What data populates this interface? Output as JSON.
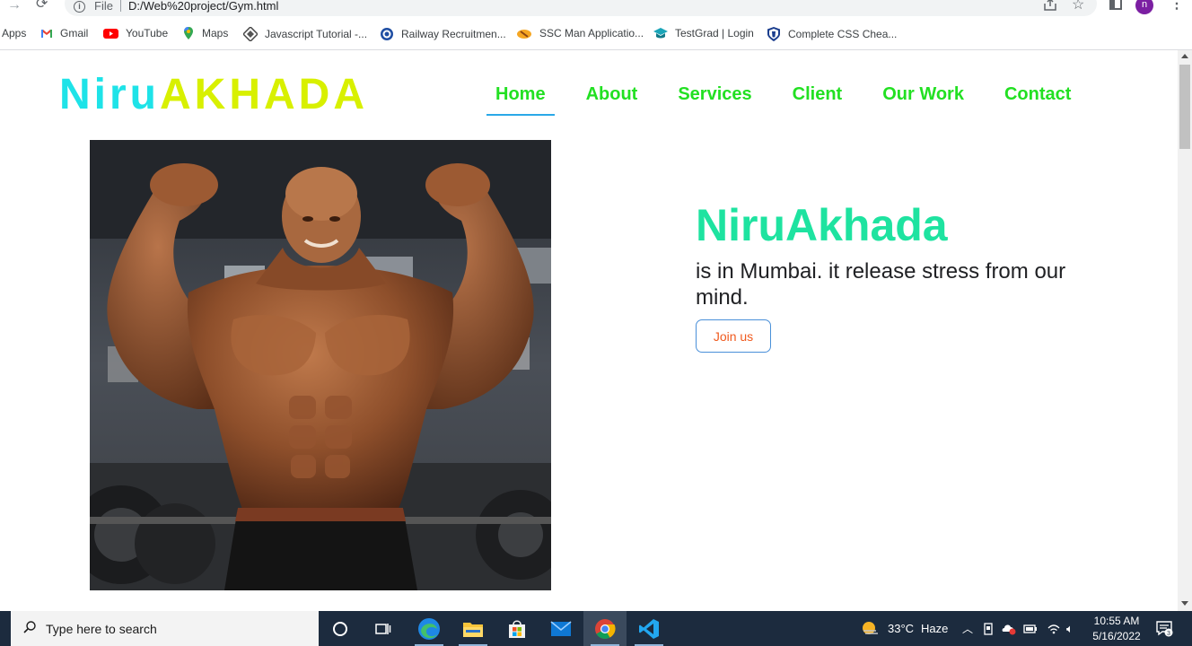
{
  "browser": {
    "url_scheme": "File",
    "url": "D:/Web%20project/Gym.html",
    "avatar_letter": "n",
    "bookmarks": [
      {
        "label": "Apps"
      },
      {
        "label": "Gmail"
      },
      {
        "label": "YouTube"
      },
      {
        "label": "Maps"
      },
      {
        "label": "Javascript Tutorial -..."
      },
      {
        "label": "Railway Recruitmen..."
      },
      {
        "label": "SSC Man Applicatio..."
      },
      {
        "label": "TestGrad | Login"
      },
      {
        "label": "Complete CSS Chea..."
      }
    ]
  },
  "site": {
    "logo_part1": "Niru",
    "logo_part2": "AKHADA",
    "nav": [
      {
        "label": "Home",
        "active": true
      },
      {
        "label": "About"
      },
      {
        "label": "Services"
      },
      {
        "label": "Client"
      },
      {
        "label": "Our Work"
      },
      {
        "label": "Contact"
      }
    ],
    "hero": {
      "title": "NiruAkhada",
      "description": "is in Mumbai. it release stress from our mind.",
      "button_label": "Join us"
    },
    "colors": {
      "logo_cyan": "#1ee3e8",
      "logo_yellow": "#d8f000",
      "nav_green": "#22e022",
      "title_teal": "#1ee3a0",
      "button_text": "#f05a1e"
    }
  },
  "taskbar": {
    "search_placeholder": "Type here to search",
    "weather_temp": "33°C",
    "weather_desc": "Haze",
    "time": "10:55 AM",
    "date": "5/16/2022",
    "notification_count": "3"
  }
}
